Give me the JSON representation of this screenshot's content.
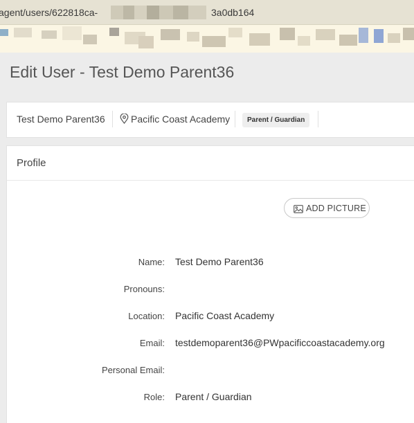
{
  "browser": {
    "url_prefix": "agent/users/622818ca-",
    "url_suffix": "3a0db164"
  },
  "page": {
    "title": "Edit User - Test Demo Parent36"
  },
  "summary": {
    "user_name": "Test Demo Parent36",
    "location": "Pacific Coast Academy",
    "role_badge": "Parent / Guardian",
    "location_icon": "map-pin-icon"
  },
  "profile": {
    "section_title": "Profile",
    "add_picture_label": "ADD PICTURE",
    "add_picture_icon": "image-icon",
    "fields": [
      {
        "label": "Name:",
        "value": "Test Demo Parent36"
      },
      {
        "label": "Pronouns:",
        "value": ""
      },
      {
        "label": "Location:",
        "value": "Pacific Coast Academy"
      },
      {
        "label": "Email:",
        "value": "testdemoparent36@PWpacificcoastacademy.org"
      },
      {
        "label": "Personal Email:",
        "value": ""
      },
      {
        "label": "Role:",
        "value": "Parent / Guardian"
      }
    ]
  }
}
